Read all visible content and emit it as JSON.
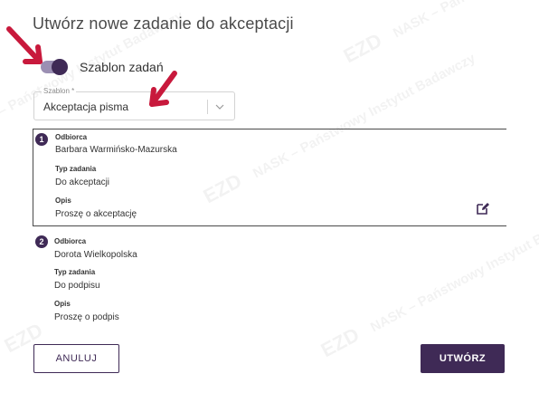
{
  "dialog": {
    "title": "Utwórz nowe zadanie do akceptacji"
  },
  "template_toggle": {
    "label": "Szablon zadań",
    "checked": true
  },
  "template_select": {
    "legend": "Szablon *",
    "value": "Akceptacja pisma"
  },
  "tasks": [
    {
      "number": "1",
      "recipient_label": "Odbiorca",
      "recipient": "Barbara Warmińsko-Mazurska",
      "type_label": "Typ zadania",
      "type": "Do akceptacji",
      "description_label": "Opis",
      "description": "Proszę o akceptację"
    },
    {
      "number": "2",
      "recipient_label": "Odbiorca",
      "recipient": "Dorota Wielkopolska",
      "type_label": "Typ zadania",
      "type": "Do podpisu",
      "description_label": "Opis",
      "description": "Proszę o podpis"
    }
  ],
  "buttons": {
    "cancel": "ANULUJ",
    "create": "UTWÓRZ"
  },
  "watermark": {
    "logo": "EZD",
    "org": "NASK – Państwowy Instytut Badawczy"
  },
  "colors": {
    "primary": "#3f2a56",
    "toggle_track": "#9b8fb3",
    "annotation": "#c8193c"
  }
}
